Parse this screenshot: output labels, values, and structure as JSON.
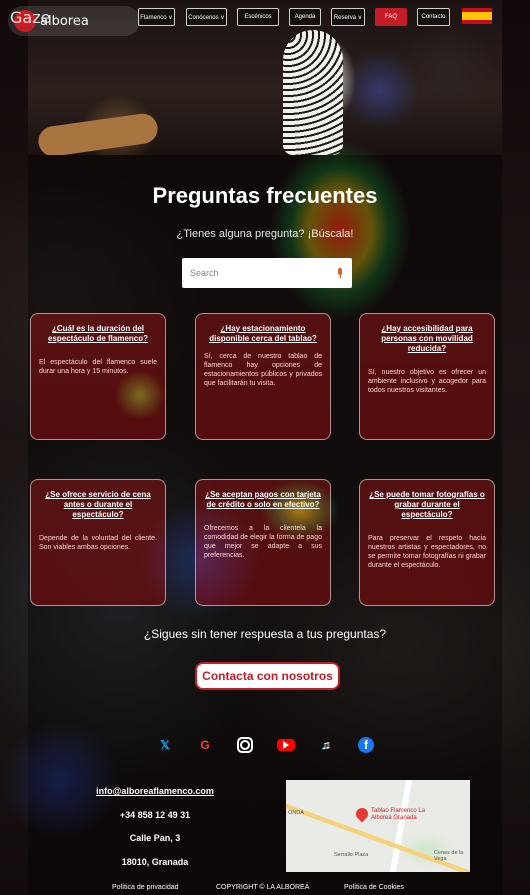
{
  "header": {
    "brand": "alborea",
    "nav_items": [
      "Flamenco ∨",
      "Conócenos ∨",
      "Escénicos",
      "Agenda",
      "Reserva ∨",
      "FAQ",
      "Contacto"
    ],
    "active_item": "FAQ",
    "language_flag_icon": "spain-flag-icon"
  },
  "main": {
    "title": "Preguntas frecuentes",
    "subtitle": "¿Tienes alguna pregunta? ¡Búscala!",
    "search": {
      "placeholder": "Search",
      "icon": "microphone-icon"
    },
    "faqs": [
      {
        "question": "¿Cuál es la duración del espectáculo de flamenco?",
        "answer": "El espectáculo del flamenco suele durar una hora y 15 minutos."
      },
      {
        "question": "¿Hay estacionamiento disponible cerca del tablao?",
        "answer": "Sí, cerca de nuestro tablao de flamenco hay opciones de estacionamientos públicos y privados que facilitarán tu visita."
      },
      {
        "question": "¿Hay accesibilidad para personas con movilidad reducida?",
        "answer": "Sí, nuestro objetivo es ofrecer un ambiente inclusivo y acogedor para todos nuestros visitantes."
      },
      {
        "question": "¿Se ofrece servicio de cena antes o durante el espectáculo?",
        "answer": "Depende de la voluntad del cliente. Son viables ambas opciones."
      },
      {
        "question": "¿Se aceptan pagos con tarjeta de crédito o solo en efectivo?",
        "answer": "Ofrecemos a la clientela la comodidad de elegir la forma de pago que mejor se adapte a sus preferencias."
      },
      {
        "question": "¿Se puede tomar fotografías o grabar durante el espectáculo?",
        "answer": "Para preservar el respeto hacia nuestros artistas y espectadores, no se permite tomar fotografías ni grabar durante el espectáculo."
      }
    ],
    "still_question": "¿Sigues sin tener respuesta a tus preguntas?",
    "contact_button": "Contacta con nosotros"
  },
  "footer": {
    "social_icons": [
      "twitter-icon",
      "google-icon",
      "instagram-icon",
      "youtube-icon",
      "tiktok-icon",
      "facebook-icon"
    ],
    "email": "info@alboreaflamenco.com",
    "phone": "+34 858 12 49 31",
    "street": "Calle Pan, 3",
    "city": "18010, Granada",
    "map": {
      "place_label": "Tablao Flamenco La Alboreá Granada",
      "labels": [
        "Serrallo Plaza",
        "Cenes de la Vega",
        "ONDA"
      ]
    },
    "links": [
      "Política de privacidad",
      "COPYRIGHT © LA ALBOREÁ",
      "Política de Cookies"
    ]
  },
  "overlay": {
    "watermark": "Gaze"
  },
  "colors": {
    "accent": "#c41d25",
    "card_bg": "#8c1414"
  }
}
